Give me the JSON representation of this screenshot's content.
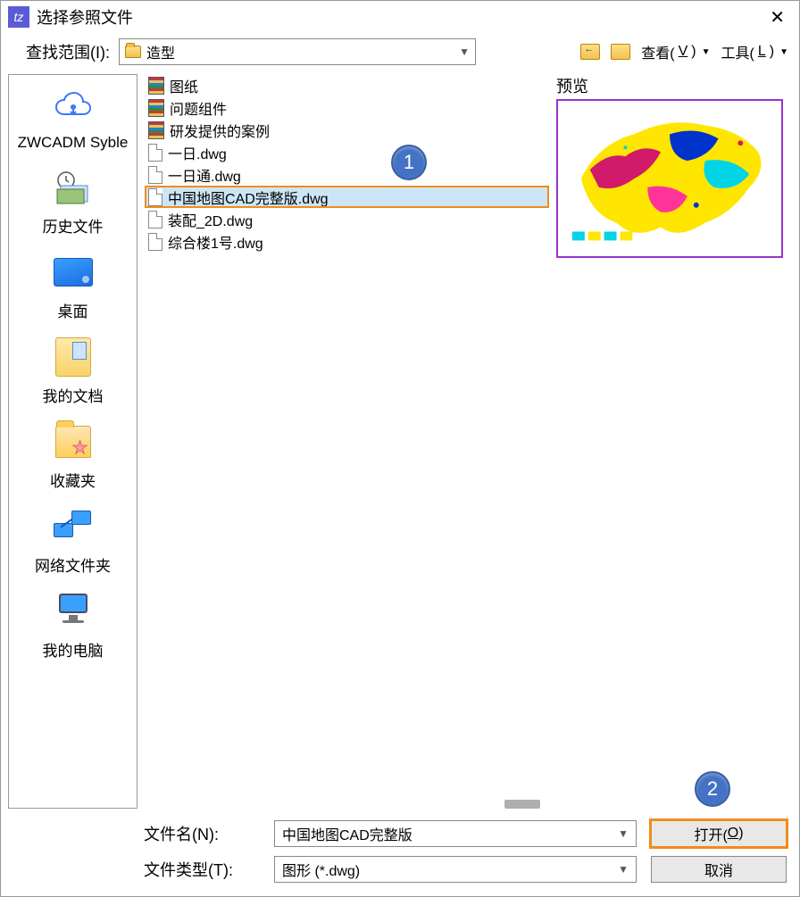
{
  "titlebar": {
    "title": "选择参照文件"
  },
  "toolbar": {
    "lookup_label": "查找范围(I):",
    "current_folder": "造型",
    "view_label": "查看(",
    "view_accel": "V",
    "view_suffix": ")",
    "tools_label": "工具(",
    "tools_accel": "L",
    "tools_suffix": ")"
  },
  "places": [
    {
      "label": "ZWCADM Syble"
    },
    {
      "label": "历史文件"
    },
    {
      "label": "桌面"
    },
    {
      "label": "我的文档"
    },
    {
      "label": "收藏夹"
    },
    {
      "label": "网络文件夹"
    },
    {
      "label": "我的电脑"
    }
  ],
  "files": [
    {
      "type": "archive",
      "name": "图纸"
    },
    {
      "type": "archive",
      "name": "问题组件"
    },
    {
      "type": "archive",
      "name": "研发提供的案例"
    },
    {
      "type": "file",
      "name": "一日.dwg"
    },
    {
      "type": "file",
      "name": "一日通.dwg"
    },
    {
      "type": "file",
      "name": "中国地图CAD完整版.dwg",
      "selected": true
    },
    {
      "type": "file",
      "name": "装配_2D.dwg"
    },
    {
      "type": "file",
      "name": "综合楼1号.dwg"
    }
  ],
  "preview": {
    "label": "预览"
  },
  "bottom": {
    "filename_label": "文件名(N):",
    "filename_value": "中国地图CAD完整版",
    "filetype_label": "文件类型(T):",
    "filetype_value": "图形 (*.dwg)",
    "open_label": "打开(",
    "open_accel": "O",
    "open_suffix": ")",
    "cancel_label": "取消"
  },
  "callouts": {
    "c1": "1",
    "c2": "2"
  }
}
